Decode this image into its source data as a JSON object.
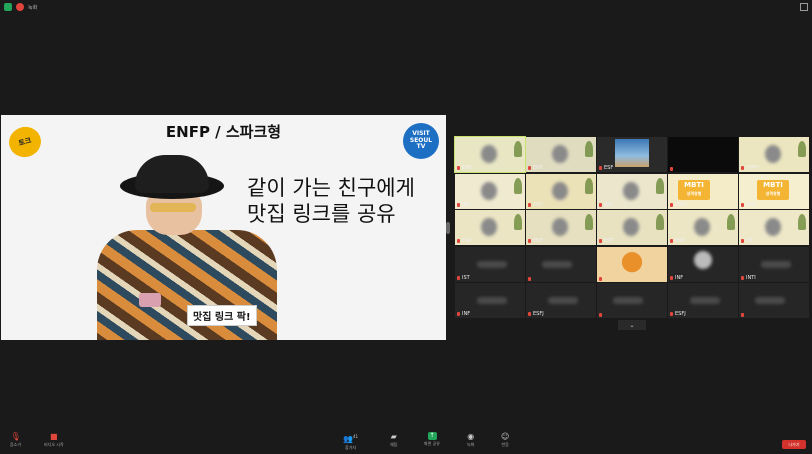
{
  "topbar": {
    "text": "녹화"
  },
  "share": {
    "logo_text": "토크",
    "header": "ENFP / 스파크형",
    "badge_line1": "VISIT",
    "badge_line2": "SEOUL",
    "badge_line3": "TV",
    "caption_line1": "같이 가는 친구에게",
    "caption_line2": "맛집 링크를 공유",
    "subtitle": "맛집 링크 팍!"
  },
  "gallery": {
    "tiles": [
      {
        "name": "ENF"
      },
      {
        "name": "ENT"
      },
      {
        "name": "ESF"
      },
      {
        "name": ""
      },
      {
        "name": "ENFP"
      },
      {
        "name": "INF"
      },
      {
        "name": "ENT"
      },
      {
        "name": "INF"
      },
      {
        "name": "MBTI"
      },
      {
        "name": "ENF"
      },
      {
        "name": "ENF"
      },
      {
        "name": "ENT"
      },
      {
        "name": "ENT"
      },
      {
        "name": "ENF"
      },
      {
        "name": "ISF"
      },
      {
        "name": "IST"
      },
      {
        "name": ""
      },
      {
        "name": ""
      },
      {
        "name": "INF"
      },
      {
        "name": "INTI"
      },
      {
        "name": "INF"
      },
      {
        "name": "ESFJ"
      },
      {
        "name": ""
      },
      {
        "name": "ESFJ"
      },
      {
        "name": ""
      }
    ],
    "mbti_poster": "MBTI",
    "mbti_poster_sub": "성격유형",
    "chevron": "⌄"
  },
  "toolbar": {
    "mute": "음소거",
    "video": "비디오 시작",
    "participants": "참가자",
    "participants_count": "41",
    "chat": "채팅",
    "share": "화면 공유",
    "record": "녹화",
    "reactions": "반응",
    "leave": "나가기"
  },
  "colors": {
    "active_border": "#c7e26c",
    "leave": "#d2312c",
    "share_green": "#23a55a",
    "mic_red": "#e0463c"
  }
}
